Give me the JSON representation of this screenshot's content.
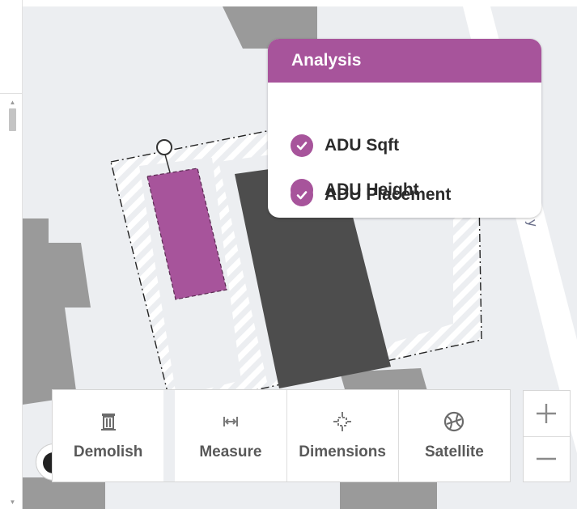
{
  "analysis": {
    "title": "Analysis",
    "items": [
      {
        "label": "ADU Sqft",
        "checked": true
      },
      {
        "label": "ADU Height",
        "checked": true
      },
      {
        "label": "ADU Placement",
        "checked": true
      }
    ]
  },
  "toolbar": {
    "demolish": {
      "label": "Demolish",
      "icon": "trash-icon"
    },
    "measure": {
      "label": "Measure",
      "icon": "ruler-icon"
    },
    "dimensions": {
      "label": "Dimensions",
      "icon": "dimensions-icon"
    },
    "satellite": {
      "label": "Satellite",
      "icon": "globe-icon"
    }
  },
  "zoom": {
    "in_icon": "plus-icon",
    "out_icon": "minus-icon"
  },
  "colors": {
    "accent": "#a7549b",
    "map_background": "#eceef1",
    "building_dark": "#4d4d4d",
    "building_gray": "#9a9a9a",
    "adu": "#a7549b"
  }
}
